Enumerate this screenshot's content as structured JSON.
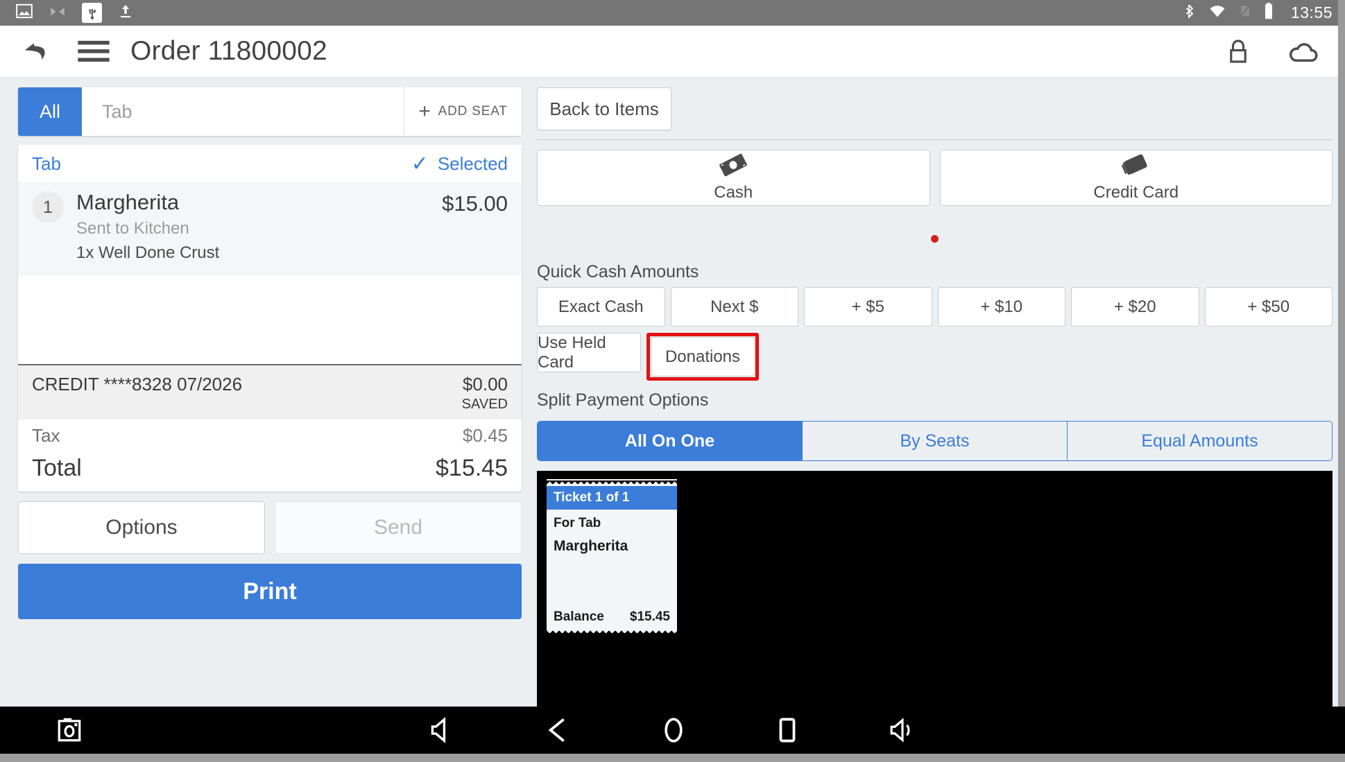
{
  "status_bar": {
    "time": "13:55",
    "left_icons": [
      "image-icon",
      "cast-off-icon",
      "usb-icon",
      "upload-icon"
    ],
    "right_icons": [
      "bluetooth-icon",
      "wifi-icon",
      "sim-card-off-icon",
      "battery-icon"
    ]
  },
  "app_bar": {
    "title": "Order 11800002",
    "back_icon": "back-arrow-icon",
    "menu_icon": "hamburger-menu-icon",
    "lock_icon": "lock-icon",
    "cloud_icon": "cloud-icon"
  },
  "left_pane": {
    "seat_tabs": {
      "all_label": "All",
      "seat_label": "Tab",
      "add_seat_label": "ADD SEAT",
      "add_seat_icon": "plus-icon"
    },
    "order": {
      "header_label": "Tab",
      "selected_label": "Selected",
      "selected_icon": "check-icon",
      "items": [
        {
          "qty": "1",
          "name": "Margherita",
          "status": "Sent to Kitchen",
          "modifier": "1x  Well Done Crust",
          "price": "$15.00"
        }
      ]
    },
    "totals": {
      "saved_label": "CREDIT ****8328 07/2026",
      "saved_value": "$0.00",
      "saved_sub": "SAVED",
      "tax_label": "Tax",
      "tax_value": "$0.45",
      "total_label": "Total",
      "total_value": "$15.45"
    },
    "actions": {
      "options_label": "Options",
      "send_label": "Send",
      "print_label": "Print"
    }
  },
  "right_pane": {
    "back_to_items_label": "Back to Items",
    "payment_methods": [
      {
        "label": "Cash",
        "icon": "cash-bill-icon"
      },
      {
        "label": "Credit Card",
        "icon": "credit-card-icon"
      }
    ],
    "quick_cash": {
      "section_label": "Quick Cash Amounts",
      "row1": [
        "Exact Cash",
        "Next $",
        "+ $5",
        "+ $10",
        "+ $20",
        "+ $50"
      ],
      "held_card_label": "Use Held Card",
      "donations_label": "Donations"
    },
    "split_payment": {
      "section_label": "Split Payment Options",
      "options": [
        "All On One",
        "By Seats",
        "Equal Amounts"
      ],
      "selected": "All On One"
    },
    "ticket": {
      "header": "Ticket 1 of 1",
      "for_label": "For Tab",
      "item": "Margherita",
      "balance_label": "Balance",
      "balance_value": "$15.45"
    }
  },
  "nav_bar": {
    "icons": [
      "screenshot-icon",
      "volume-down-icon",
      "back-triangle-icon",
      "home-circle-icon",
      "recents-square-icon",
      "volume-up-icon"
    ]
  },
  "colors": {
    "accent": "#3b7dd8",
    "highlight": "#e01111",
    "status_bar": "#757575"
  }
}
